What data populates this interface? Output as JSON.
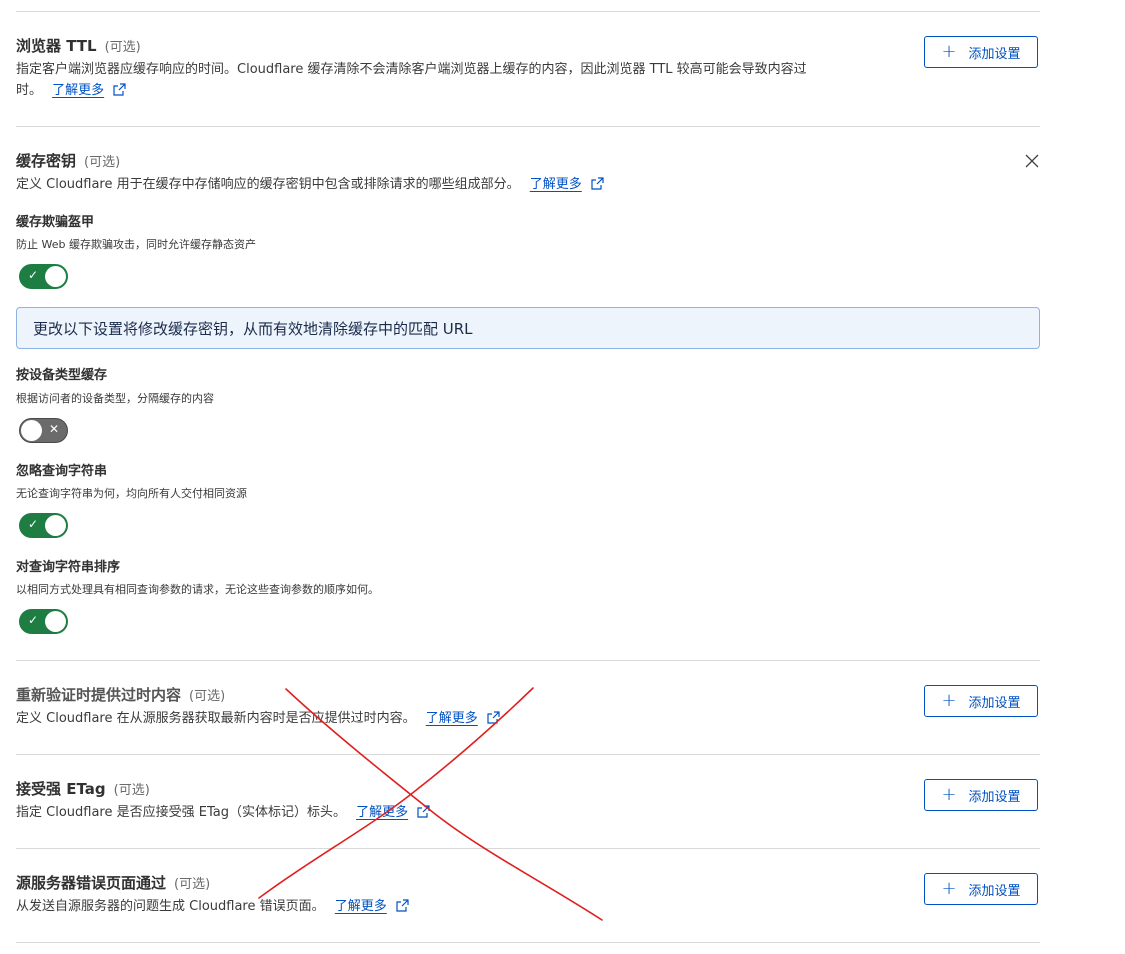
{
  "browser_ttl": {
    "title": "浏览器 TTL",
    "optional": "(可选)",
    "description": "指定客户端浏览器应缓存响应的时间。Cloudflare 缓存清除不会清除客户端浏览器上缓存的内容，因此浏览器 TTL 较高可能会导致内容过",
    "description_line2": "时。",
    "learn_more": "了解更多",
    "add_button": "添加设置"
  },
  "cache_key": {
    "title": "缓存密钥",
    "optional": "(可选)",
    "description": "定义 Cloudflare 用于在缓存中存储响应的缓存密钥中包含或排除请求的哪些组成部分。",
    "learn_more": "了解更多",
    "cache_deception_armor": {
      "title": "缓存欺骗盔甲",
      "description": "防止 Web 缓存欺骗攻击，同时允许缓存静态资产",
      "enabled": true
    },
    "info_banner": "更改以下设置将修改缓存密钥，从而有效地清除缓存中的匹配 URL",
    "cache_by_device_type": {
      "title": "按设备类型缓存",
      "description": "根据访问者的设备类型，分隔缓存的内容",
      "enabled": false
    },
    "ignore_query_string": {
      "title": "忽略查询字符串",
      "description": "无论查询字符串为何，均向所有人交付相同资源",
      "enabled": true
    },
    "sort_query_string": {
      "title": "对查询字符串排序",
      "description": "以相同方式处理具有相同查询参数的请求，无论这些查询参数的顺序如何。",
      "enabled": true
    }
  },
  "serve_stale": {
    "title": "重新验证时提供过时内容",
    "optional": "(可选)",
    "description": "定义 Cloudflare 在从源服务器获取最新内容时是否应提供过时内容。",
    "learn_more": "了解更多",
    "add_button": "添加设置"
  },
  "strong_etag": {
    "title": "接受强 ETag",
    "optional": "(可选)",
    "description": "指定 Cloudflare 是否应接受强 ETag（实体标记）标头。",
    "learn_more": "了解更多",
    "add_button": "添加设置"
  },
  "origin_error_page": {
    "title": "源服务器错误页面通过",
    "optional": "(可选)",
    "description": "从发送自源服务器的问题生成 Cloudflare 错误页面。",
    "learn_more": "了解更多",
    "add_button": "添加设置"
  },
  "icons": {
    "plus": "plus-icon",
    "external": "external-link-icon",
    "close": "close-icon",
    "check": "check-icon",
    "cross": "cross-icon"
  },
  "colors": {
    "accent": "#0051c3",
    "toggle_on": "#1e7d43",
    "toggle_off": "#6b6b6b",
    "banner_bg": "#edf4fc",
    "annotation": "#e02020"
  }
}
